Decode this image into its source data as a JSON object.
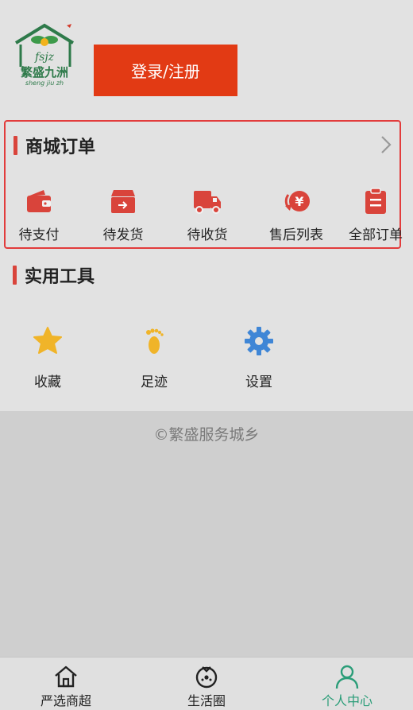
{
  "header": {
    "logo_text": "繁盛九洲",
    "logo_sub": "sheng jiu zh",
    "logo_script": "fsjz",
    "login_label": "登录/注册"
  },
  "orders": {
    "title": "商城订单",
    "items": [
      {
        "label": "待支付",
        "icon": "wallet-icon"
      },
      {
        "label": "待发货",
        "icon": "box-icon"
      },
      {
        "label": "待收货",
        "icon": "truck-icon"
      },
      {
        "label": "售后列表",
        "icon": "refund-icon"
      },
      {
        "label": "全部订单",
        "icon": "clipboard-icon"
      }
    ],
    "accent": "#d9443b"
  },
  "tools": {
    "title": "实用工具",
    "items": [
      {
        "label": "收藏",
        "icon": "star-icon",
        "color": "#f0b429"
      },
      {
        "label": "足迹",
        "icon": "footprint-icon",
        "color": "#f0b429"
      },
      {
        "label": "设置",
        "icon": "gear-icon",
        "color": "#3f86d6"
      }
    ]
  },
  "footer": {
    "copyright": "©繁盛服务城乡"
  },
  "tabbar": {
    "tabs": [
      {
        "label": "严选商超",
        "icon": "home-icon",
        "active": false
      },
      {
        "label": "生活圈",
        "icon": "clock-circle-icon",
        "active": false
      },
      {
        "label": "个人中心",
        "icon": "user-icon",
        "active": true
      }
    ],
    "active_color": "#2a9d78"
  }
}
